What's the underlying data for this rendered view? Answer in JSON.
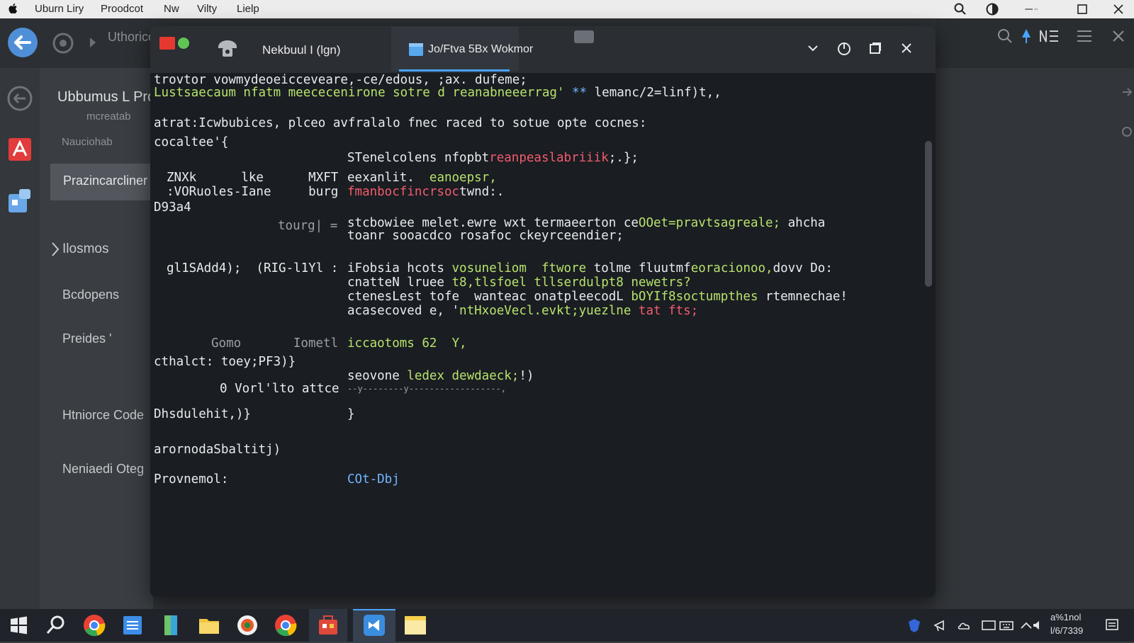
{
  "menubar": {
    "items": [
      "Uburn Liry",
      "Proodcot",
      "Nw",
      "Vilty",
      "Lielp"
    ]
  },
  "background_app": {
    "breadcrumb": "Uthorico",
    "side_title": "Ubbumus L Pro",
    "side_subtitle": "mcreatab",
    "side_label": "Nauciohab",
    "side_selected": "Prazincarcliner",
    "side_items": [
      "Ilosmos",
      "Bcdopens",
      "Preides '",
      "Htniorce Code",
      "Neniaedi Oteg"
    ]
  },
  "terminal": {
    "tabs": [
      {
        "label": "Nekbuul  I (lgn)"
      },
      {
        "label": "Jo/Ftva 5Bx Wokmor"
      }
    ],
    "lines": [
      {
        "segs": [
          {
            "t": "trovtor vowmydeoeicceveare,-ce/edous, ;ax. dufeme;",
            "c": ""
          }
        ]
      },
      {
        "segs": [
          {
            "t": "Lustsaecaum nfatm meececenirone sotre d reanabneeerrag'",
            "c": "g"
          },
          {
            "t": " ** ",
            "c": "b"
          },
          {
            "t": "lemanc/2=linf)t,,",
            "c": ""
          }
        ]
      },
      {
        "segs": [
          {
            "t": "atrat:Icwbubices, plceo avfralalo fnec raced to sotue opte cocnes:",
            "c": ""
          }
        ]
      },
      {
        "segs": [
          {
            "t": "cocaltee'{",
            "c": ""
          }
        ]
      },
      {
        "segs": [
          {
            "t": "STenelcolens nfopbt",
            "c": ""
          },
          {
            "t": "reanpeaslabriiik",
            "c": "r"
          },
          {
            "t": ";.};",
            "c": ""
          }
        ]
      },
      {
        "segs": [
          {
            "t": "ZNXk      lke      MXFT",
            "c": ""
          }
        ]
      },
      {
        "segs": [
          {
            "t": "eexanlit.  ",
            "c": ""
          },
          {
            "t": "eanoepsr,",
            "c": "g"
          }
        ]
      },
      {
        "segs": [
          {
            "t": ":VORuoles-Iane     burg",
            "c": ""
          }
        ]
      },
      {
        "segs": [
          {
            "t": "fmanbocfincrsoc",
            "c": "r"
          },
          {
            "t": "twnd:.",
            "c": ""
          }
        ]
      },
      {
        "segs": [
          {
            "t": "D93a4",
            "c": ""
          }
        ]
      },
      {
        "segs": [
          {
            "t": "tourg| =",
            "c": "dim"
          }
        ]
      },
      {
        "segs": [
          {
            "t": "stcbowiee melet.ewre wxt termaeerton ce",
            "c": ""
          },
          {
            "t": "OOet=pravtsagreale;",
            "c": "g"
          },
          {
            "t": " ahcha",
            "c": ""
          }
        ]
      },
      {
        "segs": [
          {
            "t": "toanr sooacdco rosafoc ckeyrceendier;",
            "c": ""
          }
        ]
      },
      {
        "segs": [
          {
            "t": "gl1SAdd4);  (RIG-l1Yl :",
            "c": ""
          }
        ]
      },
      {
        "segs": [
          {
            "t": "iFobsia hcots ",
            "c": ""
          },
          {
            "t": "vosuneliom  ftwore",
            "c": "g"
          },
          {
            "t": " tolme fluutmf",
            "c": ""
          },
          {
            "t": "eoracionoo,",
            "c": "g"
          },
          {
            "t": "dovv Do:",
            "c": ""
          }
        ]
      },
      {
        "segs": [
          {
            "t": "cnatteN lruee ",
            "c": ""
          },
          {
            "t": "t8,tlsfoel tllserdulpt8 newetrs?",
            "c": "g"
          }
        ]
      },
      {
        "segs": [
          {
            "t": "ctenesLest tofe  wanteac onatpleecodL ",
            "c": ""
          },
          {
            "t": "bOYIf8soctumpthes",
            "c": "g"
          },
          {
            "t": " rtemnechae!",
            "c": ""
          }
        ]
      },
      {
        "segs": [
          {
            "t": "acasecoved e, '",
            "c": ""
          },
          {
            "t": "ntHxoeVecl.evkt;yuezlne",
            "c": "g"
          },
          {
            "t": " tat fts;",
            "c": "r"
          }
        ]
      },
      {
        "segs": [
          {
            "t": "Gomo       Iometl",
            "c": "dim"
          }
        ]
      },
      {
        "segs": [
          {
            "t": "iccaotoms 62  Y,",
            "c": "g"
          }
        ]
      },
      {
        "segs": [
          {
            "t": "cthalct: toey;PF3)}",
            "c": ""
          }
        ]
      },
      {
        "segs": [
          {
            "t": "seovone ",
            "c": ""
          },
          {
            "t": "ledex dewdaeck;",
            "c": "g"
          },
          {
            "t": "!)",
            "c": ""
          }
        ]
      },
      {
        "segs": [
          {
            "t": "0 Vorl'lto attce",
            "c": ""
          }
        ]
      },
      {
        "segs": [
          {
            "t": "--y--------y------------------,",
            "c": "dim"
          }
        ]
      },
      {
        "segs": [
          {
            "t": "Dhsdulehit,)}",
            "c": ""
          }
        ]
      },
      {
        "segs": [
          {
            "t": "}",
            "c": ""
          }
        ]
      },
      {
        "segs": [
          {
            "t": "arornodaSbaltitj)",
            "c": ""
          }
        ]
      },
      {
        "segs": [
          {
            "t": "Provnemol:",
            "c": ""
          }
        ]
      },
      {
        "segs": [
          {
            "t": "COt-Dbj",
            "c": "b"
          }
        ]
      }
    ]
  },
  "taskbar": {
    "clock_time": "a%1nol",
    "clock_date": "l/6/7339"
  },
  "colors": {
    "accent": "#4aa3ff",
    "green_text": "#b7e36b",
    "red_text": "#f25c6d",
    "terminal_bg": "#1a1d22"
  }
}
